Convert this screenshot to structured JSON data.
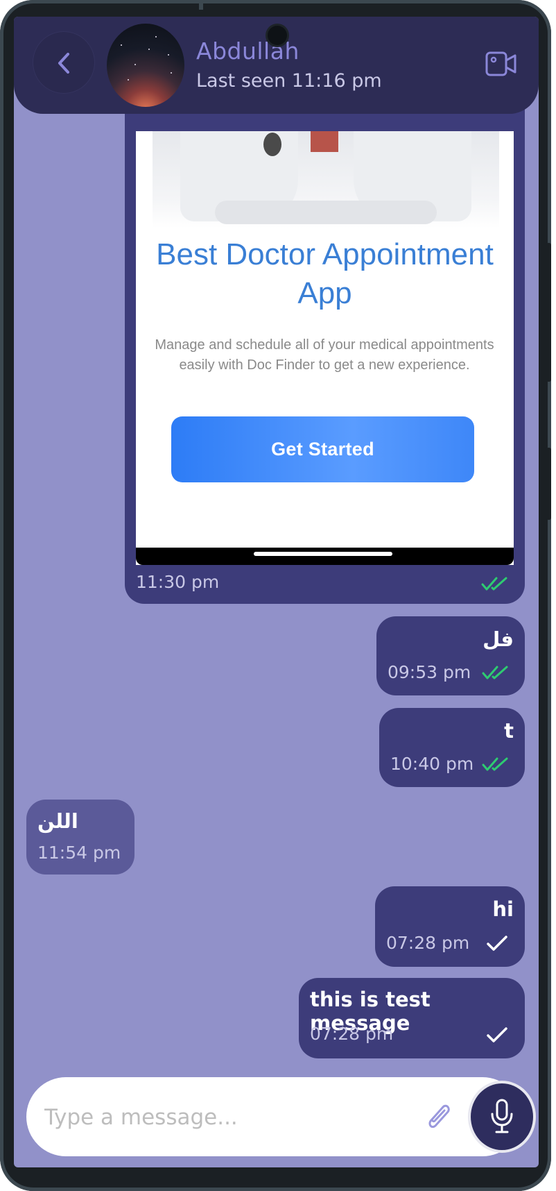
{
  "header": {
    "back_icon": "chevron-left-icon",
    "contact_name": "Abdullah",
    "last_seen": "Last seen 11:16 pm",
    "video_icon": "video-camera-icon"
  },
  "messages": [
    {
      "type": "image",
      "direction": "outgoing",
      "time": "11:30 pm",
      "status": "read",
      "image": {
        "title": "Best Doctor Appointment App",
        "description": "Manage and schedule all of your medical appointments easily with Doc Finder to get a new experience.",
        "button_label": "Get Started"
      }
    },
    {
      "type": "text",
      "direction": "outgoing",
      "text": "فل",
      "time": "09:53 pm",
      "status": "read"
    },
    {
      "type": "text",
      "direction": "outgoing",
      "text": "t",
      "time": "10:40 pm",
      "status": "read"
    },
    {
      "type": "text",
      "direction": "incoming",
      "text": "اللن",
      "time": "11:54 pm"
    },
    {
      "type": "text",
      "direction": "outgoing",
      "text": "hi",
      "time": "07:28 pm",
      "status": "sent"
    },
    {
      "type": "text",
      "direction": "outgoing",
      "text": "this is test message",
      "time": "07:28 pm",
      "status": "sent"
    }
  ],
  "composer": {
    "placeholder": "Type a message...",
    "attach_icon": "paperclip-icon",
    "mic_icon": "microphone-icon"
  },
  "colors": {
    "chat_background": "#9191c9",
    "header_background": "#2d2c55",
    "outgoing_bubble": "#3d3c7a",
    "incoming_bubble": "#5b5a99",
    "read_tick": "#2ecc71",
    "sent_tick": "#ffffff"
  }
}
